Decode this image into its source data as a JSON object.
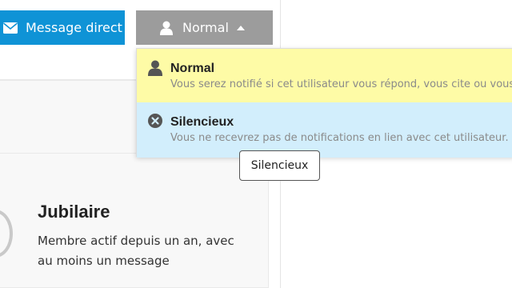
{
  "buttons": {
    "direct_message": "Message direct",
    "notification_level": "Normal"
  },
  "dropdown": {
    "items": [
      {
        "title": "Normal",
        "description": "Vous serez notifié si cet utilisateur vous répond, vous cite ou vous"
      },
      {
        "title": "Silencieux",
        "description": "Vous ne recevrez pas de notifications en lien avec cet utilisateur."
      }
    ]
  },
  "tooltip": "Silencieux",
  "badge": {
    "title": "Jubilaire",
    "description": "Membre actif depuis un an, avec au moins un message"
  },
  "colors": {
    "primary_button": "#0f93d6",
    "secondary_button": "#9c9c9c",
    "highlight_yellow": "#fefba6",
    "highlight_blue": "#d2eefc"
  },
  "icons": {
    "direct_message": "envelope-icon",
    "notification_level": "user-icon",
    "caret": "caret-up-icon",
    "normal_item": "user-icon",
    "silent_item": "times-circle-icon"
  }
}
